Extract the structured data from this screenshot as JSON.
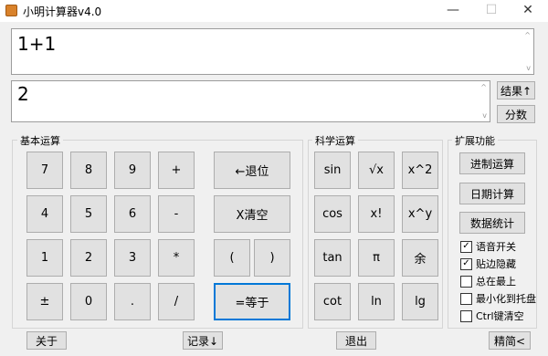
{
  "window": {
    "title": "小明计算器v4.0",
    "minimize_glyph": "—",
    "maximize_glyph": "☐",
    "close_glyph": "✕"
  },
  "display": {
    "expression": "1+1",
    "result": "2",
    "scroll_up": "^",
    "scroll_down": "v"
  },
  "side_buttons": {
    "result_up": "结果↑",
    "fraction": "分数"
  },
  "basic": {
    "label": "基本运算",
    "keys": [
      "7",
      "8",
      "9",
      "+",
      "4",
      "5",
      "6",
      "-",
      "1",
      "2",
      "3",
      "*",
      "±",
      "0",
      ".",
      "/"
    ],
    "backspace": "←退位",
    "clear": "X清空",
    "lparen": "(",
    "rparen": ")",
    "equals": "=等于"
  },
  "science": {
    "label": "科学运算",
    "keys": [
      "sin",
      "√x",
      "x^2",
      "cos",
      "x!",
      "x^y",
      "tan",
      "π",
      "余",
      "cot",
      "ln",
      "lg"
    ]
  },
  "extend": {
    "label": "扩展功能",
    "buttons": [
      "进制运算",
      "日期计算",
      "数据统计"
    ],
    "options": [
      {
        "label": "语音开关",
        "checked": true
      },
      {
        "label": "贴边隐藏",
        "checked": true
      },
      {
        "label": "总在最上",
        "checked": false
      },
      {
        "label": "最小化到托盘",
        "checked": false
      },
      {
        "label": "Ctrl键清空",
        "checked": false
      }
    ]
  },
  "bottom": {
    "about": "关于",
    "history": "记录↓",
    "exit": "退出",
    "simple": "精简<"
  }
}
